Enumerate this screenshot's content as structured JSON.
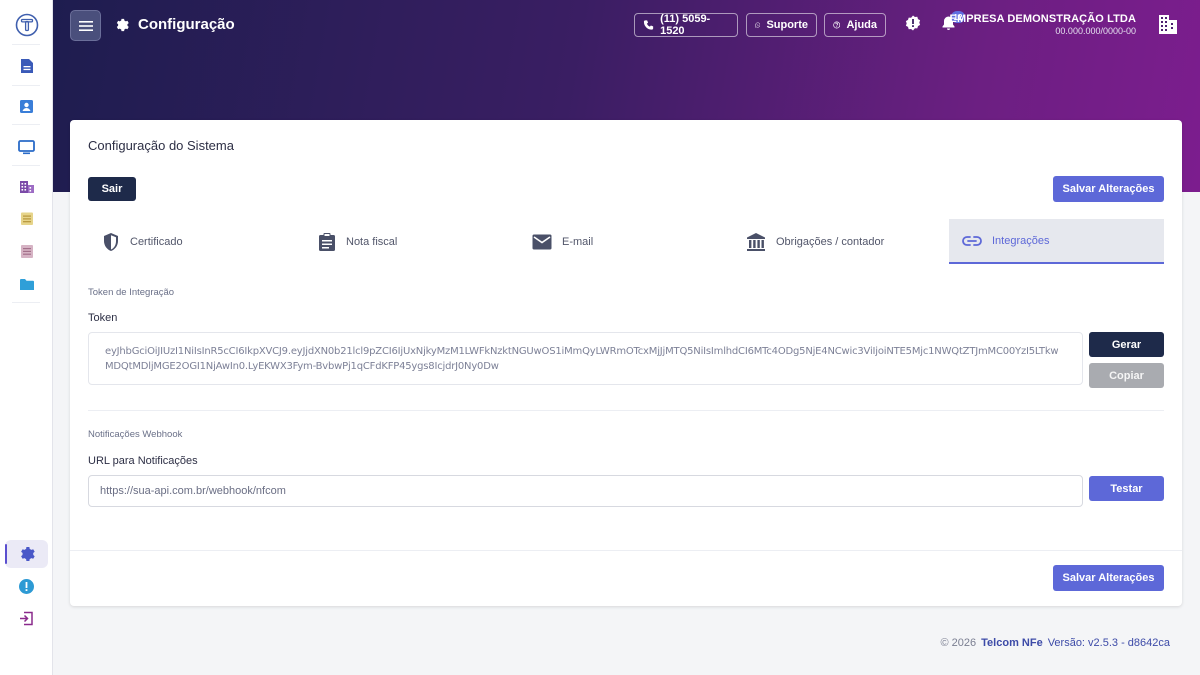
{
  "header": {
    "title": "Configuração",
    "phone": "(11) 5059-1520",
    "support": "Suporte",
    "help": "Ajuda",
    "notifications_count": "12",
    "company_name": "EMPRESA DEMONSTRAÇÃO LTDA",
    "company_doc": "00.000.000/0000-00"
  },
  "sidebar": {
    "items": [
      {
        "icon": "logo-icon"
      },
      {
        "icon": "document-icon"
      },
      {
        "icon": "contact-card-icon"
      },
      {
        "icon": "monitor-icon"
      },
      {
        "icon": "building-icon"
      },
      {
        "icon": "notepad-icon"
      },
      {
        "icon": "list-document-icon"
      },
      {
        "icon": "folder-icon"
      },
      {
        "icon": "gear-icon"
      },
      {
        "icon": "alert-badge-icon"
      },
      {
        "icon": "logout-icon"
      }
    ]
  },
  "card": {
    "title": "Configuração do Sistema",
    "exit_label": "Sair",
    "save_label": "Salvar Alterações"
  },
  "tabs": [
    {
      "label": "Certificado",
      "icon": "shield-icon"
    },
    {
      "label": "Nota fiscal",
      "icon": "clipboard-icon"
    },
    {
      "label": "E-mail",
      "icon": "mail-icon"
    },
    {
      "label": "Obrigações / contador",
      "icon": "bank-icon"
    },
    {
      "label": "Integrações",
      "icon": "link-icon",
      "active": true
    }
  ],
  "integration": {
    "section_token": "Token de Integração",
    "token_label": "Token",
    "token_value": "eyJhbGciOiJIUzI1NiIsInR5cCI6IkpXVCJ9.eyJjdXN0b21lcl9pZCI6IjUxNjkyMzM1LWFkNzktNGUwOS1iMmQyLWRmOTcxMjJjMTQ5NiIsImlhdCI6MTc4ODg5NjE4NCwic3ViIjoiNTE5Mjc1NWQtZTJmMC00YzI5LTkwMDQtMDljMGE2OGI1NjAwIn0.LyEKWX3Fym-BvbwPj1qCFdKFP45ygs8IcjdrJ0Ny0Dw",
    "generate_label": "Gerar",
    "copy_label": "Copiar",
    "section_webhook": "Notificações Webhook",
    "url_label": "URL para Notificações",
    "url_placeholder": "https://sua-api.com.br/webhook/nfcom",
    "test_label": "Testar"
  },
  "footer": {
    "copyright": "© 2026",
    "brand": "Telcom NFe",
    "version": "Versão: v2.5.3 - d8642ca"
  },
  "colors": {
    "accent": "#5d68d8",
    "dark_button": "#1e2a4a",
    "gradient_start": "#1e1d4f",
    "gradient_end": "#7c1d8e"
  }
}
